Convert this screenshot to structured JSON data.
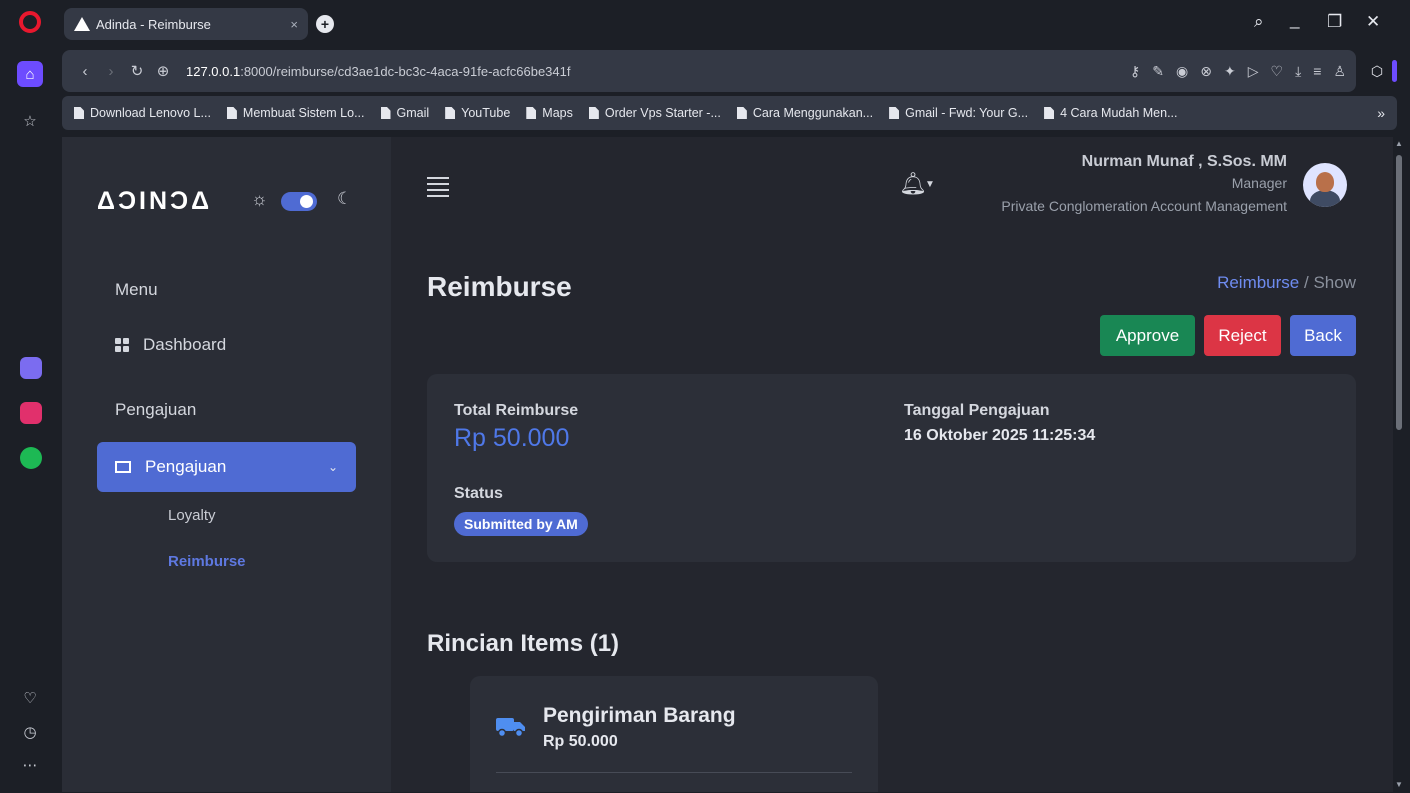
{
  "browser": {
    "tab_title": "Adinda - Reimburse",
    "tab_close": "×",
    "new_tab": "+",
    "url_host": "127.0.0.1",
    "url_path": ":8000/reimburse/cd3ae1dc-bc3c-4aca-91fe-acfc66be341f",
    "bookmarks": [
      "Download Lenovo L...",
      "Membuat Sistem Lo...",
      "Gmail",
      "YouTube",
      "Maps",
      "Order Vps Starter -...",
      "Cara Menggunakan...",
      "Gmail - Fwd: Your G...",
      "4 Cara Mudah Men..."
    ],
    "bookmarks_more": "»",
    "accent_color": "#6d4cff"
  },
  "sidebar": {
    "brand": "ΔƆINƆΔ",
    "menu_heading": "Menu",
    "dashboard_label": "Dashboard",
    "pengajuan_heading": "Pengajuan",
    "pengajuan_label": "Pengajuan",
    "sub_items": [
      "Loyalty",
      "Reimburse"
    ],
    "active_color": "#4f6bd3"
  },
  "header": {
    "user_name": "Nurman Munaf , S.Sos. MM",
    "user_role": "Manager",
    "user_org": "Private Conglomeration Account Management"
  },
  "main": {
    "title": "Reimburse",
    "breadcrumb": [
      "Reimburse",
      "Show"
    ],
    "breadcrumb_sep": "/",
    "buttons": {
      "approve": "Approve",
      "reject": "Reject",
      "back": "Back"
    },
    "summary": {
      "total_label": "Total Reimburse",
      "total_value": "Rp 50.000",
      "date_label": "Tanggal Pengajuan",
      "date_value": "16 Oktober 2025 11:25:34",
      "status_label": "Status",
      "status_value": "Submitted by AM"
    },
    "items_title": "Rincian Items (1)",
    "items": [
      {
        "name": "Pengiriman Barang",
        "amount": "Rp 50.000",
        "icon": "truck-icon"
      }
    ]
  }
}
